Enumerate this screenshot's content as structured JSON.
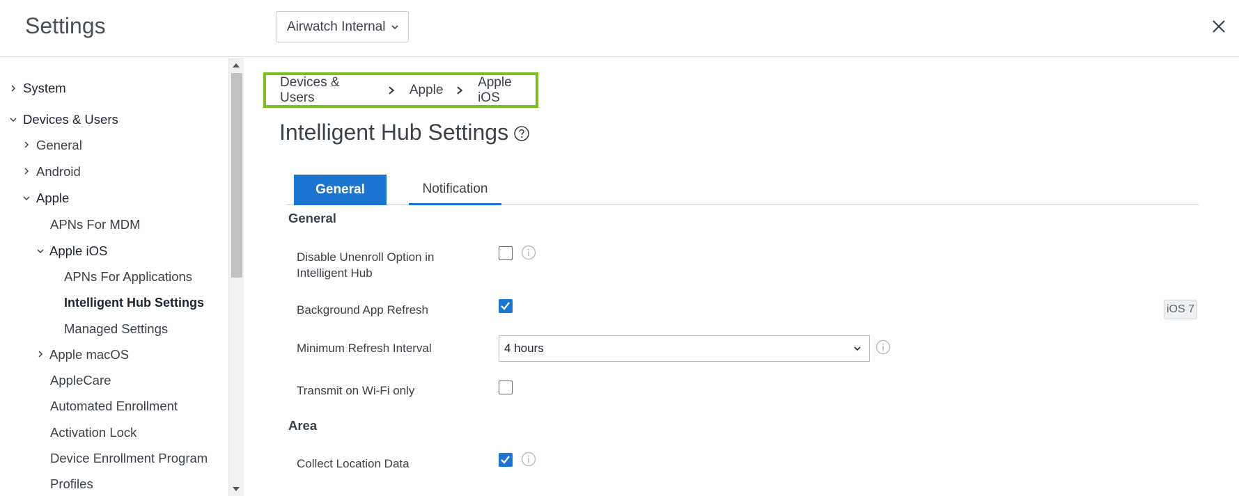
{
  "header": {
    "title": "Settings",
    "org_selector": "Airwatch Internal"
  },
  "sidebar": {
    "items": [
      {
        "label": "System"
      },
      {
        "label": "Devices & Users"
      },
      {
        "label": "General"
      },
      {
        "label": "Android"
      },
      {
        "label": "Apple"
      },
      {
        "label": "APNs For MDM"
      },
      {
        "label": "Apple iOS"
      },
      {
        "label": "APNs For Applications"
      },
      {
        "label": "Intelligent Hub Settings"
      },
      {
        "label": "Managed Settings"
      },
      {
        "label": "Apple macOS"
      },
      {
        "label": "AppleCare"
      },
      {
        "label": "Automated Enrollment"
      },
      {
        "label": "Activation Lock"
      },
      {
        "label": "Device Enrollment Program"
      },
      {
        "label": "Profiles"
      }
    ]
  },
  "breadcrumb": [
    "Devices & Users",
    "Apple",
    "Apple iOS"
  ],
  "page_title": "Intelligent Hub Settings",
  "tabs": [
    {
      "label": "General",
      "active": true
    },
    {
      "label": "Notification",
      "active": false
    }
  ],
  "sections": {
    "general": "General",
    "area": "Area"
  },
  "fields": {
    "disable_unenroll_line1": "Disable Unenroll Option in",
    "disable_unenroll_line2": "Intelligent Hub",
    "disable_unenroll_checked": false,
    "background_refresh": "Background App Refresh",
    "background_refresh_checked": true,
    "background_refresh_badge": "iOS 7",
    "min_refresh_interval": "Minimum Refresh Interval",
    "min_refresh_value": "4 hours",
    "transmit_wifi": "Transmit on Wi-Fi only",
    "transmit_wifi_checked": false,
    "collect_location": "Collect Location Data",
    "collect_location_checked": true
  },
  "colors": {
    "accent": "#1b75d1",
    "highlight_box": "#7bbe25"
  }
}
